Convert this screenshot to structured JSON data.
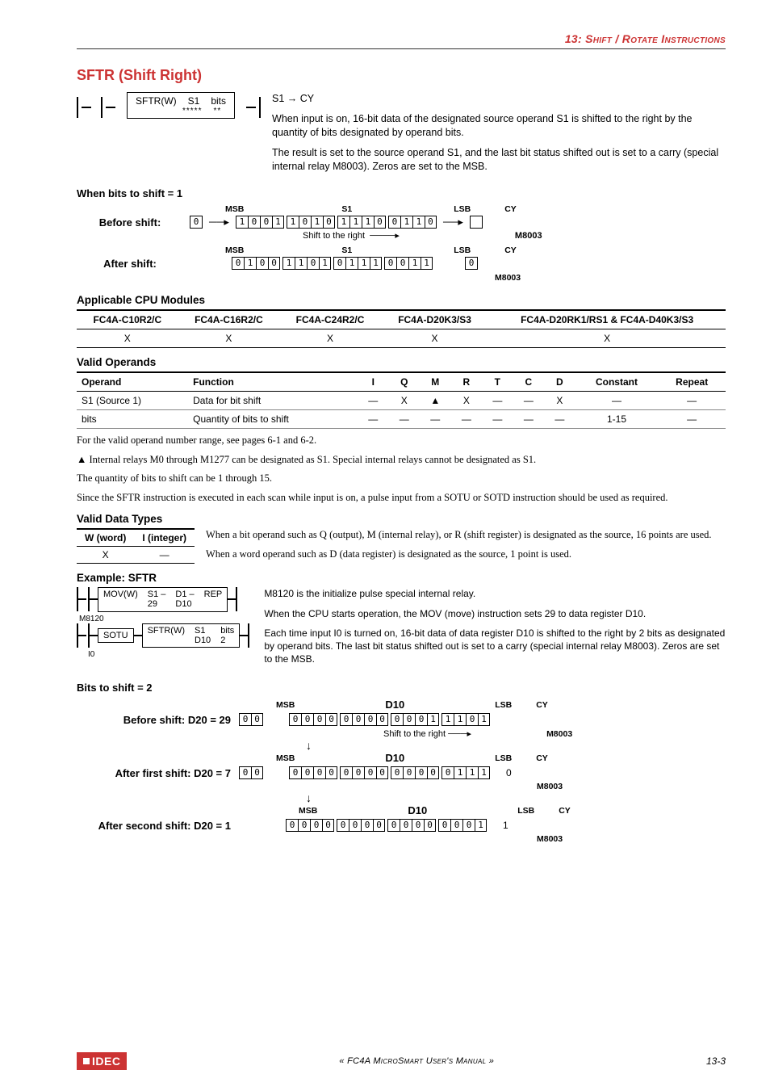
{
  "header": {
    "chap_num": "13: ",
    "chap_title_a": "Shift",
    "chap_sep": " / ",
    "chap_title_b": "Rotate Instructions"
  },
  "section_title": "SFTR (Shift Right)",
  "instr_box": {
    "name": "SFTR(W)",
    "p1": "S1",
    "p2": "bits",
    "s1": "*****",
    "s2": "**"
  },
  "instr_desc": {
    "line0": "S1 → CY",
    "line1": "When input is on, 16-bit data of the designated source operand S1 is shifted to the right by the quantity of bits designated by operand bits.",
    "line2": "The result is set to the source operand S1, and the last bit status shifted out is set to a carry (special internal relay M8003). Zeros are set to the MSB."
  },
  "shift_diag": {
    "heading": "When bits to shift = 1",
    "msb": "MSB",
    "lsb": "LSB",
    "cy": "CY",
    "s1": "S1",
    "m8003": "M8003",
    "before_label": "Before shift:",
    "after_label": "After shift:",
    "pre_box": "0",
    "before_bits": [
      [
        "1",
        "0",
        "0",
        "1"
      ],
      [
        "1",
        "0",
        "1",
        "0"
      ],
      [
        "1",
        "1",
        "1",
        "0"
      ],
      [
        "0",
        "1",
        "1",
        "0"
      ]
    ],
    "shift_note": "Shift to the right",
    "after_bits": [
      [
        "0",
        "1",
        "0",
        "0"
      ],
      [
        "1",
        "1",
        "0",
        "1"
      ],
      [
        "0",
        "1",
        "1",
        "1"
      ],
      [
        "0",
        "0",
        "1",
        "1"
      ]
    ],
    "after_cy": "0"
  },
  "applicable_heading": "Applicable CPU Modules",
  "cpu_table": {
    "cols": [
      "FC4A-C10R2/C",
      "FC4A-C16R2/C",
      "FC4A-C24R2/C",
      "FC4A-D20K3/S3",
      "FC4A-D20RK1/RS1 & FC4A-D40K3/S3"
    ],
    "row": [
      "X",
      "X",
      "X",
      "X",
      "X"
    ]
  },
  "valid_operands_heading": "Valid Operands",
  "ops_table": {
    "head": [
      "Operand",
      "Function",
      "I",
      "Q",
      "M",
      "R",
      "T",
      "C",
      "D",
      "Constant",
      "Repeat"
    ],
    "rows": [
      {
        "op": "S1 (Source 1)",
        "fn": "Data for bit shift",
        "cols": [
          "—",
          "X",
          "▲",
          "X",
          "—",
          "—",
          "X",
          "—",
          "—"
        ]
      },
      {
        "op": "bits",
        "fn": "Quantity of bits to shift",
        "cols": [
          "—",
          "—",
          "—",
          "—",
          "—",
          "—",
          "—",
          "1-15",
          "—"
        ]
      }
    ]
  },
  "body_para1": "For the valid operand number range, see pages 6-1 and 6-2.",
  "body_para2": "▲ Internal relays M0 through M1277 can be designated as S1. Special internal relays cannot be designated as S1.",
  "body_para3": "The quantity of bits to shift can be 1 through 15.",
  "body_para4": "Since the SFTR instruction is executed in each scan while input is on, a pulse input from a SOTU or SOTD instruction should be used as required.",
  "valid_dt_heading": "Valid Data Types",
  "dt_table": {
    "h1": "W (word)",
    "h2": "I (integer)",
    "v1": "X",
    "v2": "—"
  },
  "dt_text1": "When a bit operand such as Q (output), M (internal relay), or R (shift register) is designated as the source, 16 points are used.",
  "dt_text2": "When a word operand such as D (data register) is designated as the source, 1 point is used.",
  "example_heading": "Example: SFTR",
  "example_ladder": {
    "row1": {
      "left": "M8120",
      "box_name": "MOV(W)",
      "c1a": "S1 –",
      "c1b": "29",
      "c2a": "D1 –",
      "c2b": "D10",
      "c3": "REP"
    },
    "row2": {
      "left": "I0",
      "b1": "SOTU",
      "box_name": "SFTR(W)",
      "c1a": "S1",
      "c1b": "D10",
      "c2a": "bits",
      "c2b": "2"
    }
  },
  "example_text": {
    "p1": "M8120 is the initialize pulse special internal relay.",
    "p2": "When the CPU starts operation, the MOV (move) instruction sets 29 to data register D10.",
    "p3": "Each time input I0 is turned on, 16-bit data of data register D10 is shifted to the right by 2 bits as designated by operand bits. The last bit status shifted out is set to a carry (special internal relay M8003). Zeros are set to the MSB."
  },
  "bs2": {
    "heading": "Bits to shift = 2",
    "msb": "MSB",
    "lsb": "LSB",
    "cy": "CY",
    "d10": "D10",
    "m8003": "M8003",
    "before_label": "Before shift: D20 = 29",
    "after1_label": "After first shift: D20 = 7",
    "after2_label": "After second shift: D20 = 1",
    "pre": [
      "0",
      "0"
    ],
    "before_bits": [
      [
        "0",
        "0",
        "0",
        "0"
      ],
      [
        "0",
        "0",
        "0",
        "0"
      ],
      [
        "0",
        "0",
        "0",
        "1"
      ],
      [
        "1",
        "1",
        "0",
        "1"
      ]
    ],
    "after1_bits": [
      [
        "0",
        "0",
        "0",
        "0"
      ],
      [
        "0",
        "0",
        "0",
        "0"
      ],
      [
        "0",
        "0",
        "0",
        "0"
      ],
      [
        "0",
        "1",
        "1",
        "1"
      ]
    ],
    "after1_cy": "0",
    "after2_bits": [
      [
        "0",
        "0",
        "0",
        "0"
      ],
      [
        "0",
        "0",
        "0",
        "0"
      ],
      [
        "0",
        "0",
        "0",
        "0"
      ],
      [
        "0",
        "0",
        "0",
        "1"
      ]
    ],
    "after2_cy": "1",
    "shift_note": "Shift to the right"
  },
  "footer": {
    "logo": "IDEC",
    "mid_a": "« FC4A ",
    "mid_b": "MicroSmart User's Manual",
    "mid_c": " »",
    "page": "13-3"
  }
}
